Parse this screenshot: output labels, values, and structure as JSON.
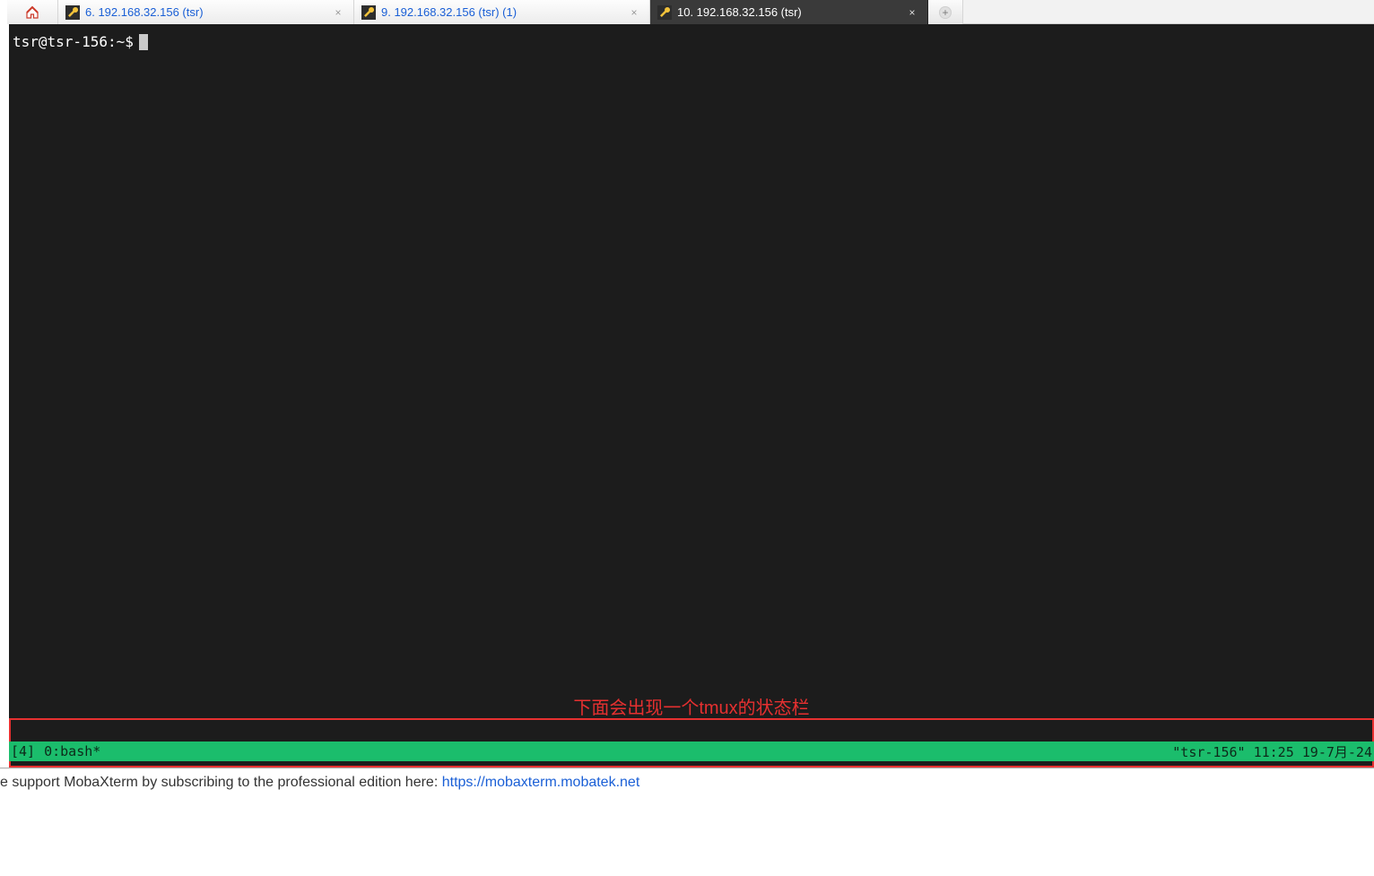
{
  "tabs": {
    "home": {},
    "items": [
      {
        "label": "6. 192.168.32.156 (tsr)",
        "active": false
      },
      {
        "label": "9. 192.168.32.156 (tsr) (1)",
        "active": false
      },
      {
        "label": "10. 192.168.32.156 (tsr)",
        "active": true
      }
    ]
  },
  "terminal": {
    "prompt": "tsr@tsr-156:~$"
  },
  "annotation": {
    "text": "下面会出现一个tmux的状态栏"
  },
  "tmux": {
    "session": "[4]",
    "window": "0:bash*",
    "host": "\"tsr-156\"",
    "time": "11:25",
    "date": "19-7月-24"
  },
  "footer": {
    "text_prefix": "e support MobaXterm by subscribing to the professional edition here: ",
    "link": "https://mobaxterm.mobatek.net"
  }
}
